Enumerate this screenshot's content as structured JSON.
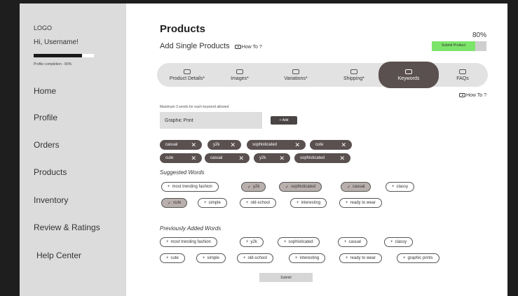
{
  "sidebar": {
    "logo": "LOGO",
    "greeting": "Hi, Username!",
    "profile_completion_label": "Profile completion - 80%",
    "profile_completion": 0.8,
    "nav": [
      "Home",
      "Profile",
      "Orders",
      "Products",
      "Inventory",
      "Review & Ratings",
      "Help Center"
    ]
  },
  "header": {
    "title": "Products",
    "subtitle": "Add Single Products",
    "how_to": "How To ?",
    "percent": "80%",
    "submit_product": "Submit Product",
    "submit_progress": 0.8
  },
  "tabs": [
    {
      "label": "Product Details*",
      "icon": "tag-icon"
    },
    {
      "label": "Images*",
      "icon": "image-icon"
    },
    {
      "label": "Variations*",
      "icon": "variations-icon"
    },
    {
      "label": "Shipping*",
      "icon": "truck-icon"
    },
    {
      "label": "Keywords",
      "icon": "keywords-icon"
    },
    {
      "label": "FAQs",
      "icon": "faq-icon"
    }
  ],
  "active_tab": 4,
  "keywords": {
    "how_to": "How To ?",
    "note": "Maximum 3 words for each keyword allowed",
    "input_value": "Graphic Print",
    "add_label": "+ Add",
    "selected": [
      "casual",
      "y2k",
      "sophisticated",
      "cute",
      "cute",
      "casual",
      "y2k",
      "sophisticated"
    ],
    "suggested_label": "Suggested Words",
    "suggested": [
      {
        "text": "most trending fashion",
        "checked": false
      },
      {
        "text": "y2k",
        "checked": true
      },
      {
        "text": "sophisticated",
        "checked": true
      },
      {
        "text": "casual",
        "checked": true
      },
      {
        "text": "classy",
        "checked": false
      },
      {
        "text": "cute",
        "checked": true
      },
      {
        "text": "simple",
        "checked": false
      },
      {
        "text": "old-school",
        "checked": false
      },
      {
        "text": "interesting",
        "checked": false
      },
      {
        "text": "ready to wear",
        "checked": false
      }
    ],
    "previous_label": "Previously Added Words",
    "previous": [
      "most trending fashion",
      "y2k",
      "sophisticated",
      "casual",
      "classy",
      "cute",
      "simple",
      "old-school",
      "interesting",
      "ready to wear",
      "graphic prints"
    ],
    "submit_label": "Submit"
  }
}
